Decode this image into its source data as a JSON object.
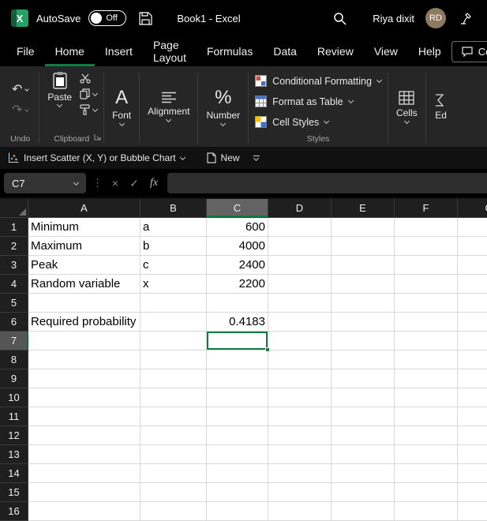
{
  "colors": {
    "accent_green": "#107C41",
    "logo_green": "#21A366",
    "logo_green_dark": "#185C37",
    "avatar_bg": "#8E7962",
    "icon_blue": "#5B9BD5"
  },
  "icons": {
    "undo": "↶",
    "redo": "↷",
    "vertical_dots": "⋮",
    "close": "×",
    "check": "✓",
    "logo_letter": "X"
  },
  "title_bar": {
    "autosave_label": "AutoSave",
    "autosave_state": "Off",
    "workbook_title": "Book1 -  Excel",
    "user_name": "Riya dixit",
    "user_initials": "RD"
  },
  "menu": {
    "items": [
      {
        "label": "File"
      },
      {
        "label": "Home",
        "active": true
      },
      {
        "label": "Insert"
      },
      {
        "label": "Page Layout"
      },
      {
        "label": "Formulas"
      },
      {
        "label": "Data"
      },
      {
        "label": "Review"
      },
      {
        "label": "View"
      },
      {
        "label": "Help"
      }
    ],
    "comments_label": "Com"
  },
  "ribbon": {
    "paste_label": "Paste",
    "font_button_label": "Font",
    "font_glyph": "A",
    "alignment_button_label": "Alignment",
    "number_button_label": "Number",
    "number_glyph": "%",
    "conditional_formatting_label": "Conditional Formatting",
    "format_as_table_label": "Format as Table",
    "cell_styles_label": "Cell Styles",
    "cells_button_label": "Cells",
    "editing_button_label": "Ed",
    "group_labels": {
      "undo": "Undo",
      "clipboard": "Clipboard",
      "styles": "Styles"
    }
  },
  "quick_toolbar": {
    "scatter_label": "Insert Scatter (X, Y) or Bubble Chart",
    "new_label": "New"
  },
  "formula_bar": {
    "name_box": "C7",
    "fx_label": "fx",
    "formula_value": ""
  },
  "sheet": {
    "columns": [
      "A",
      "B",
      "C",
      "D",
      "E",
      "F",
      "G"
    ],
    "selected_column": "C",
    "selected_row": 7,
    "selected_cell": "C7",
    "rows": [
      {
        "n": 1,
        "A": "Minimum",
        "B": "a",
        "C": "600"
      },
      {
        "n": 2,
        "A": "Maximum",
        "B": "b",
        "C": "4000"
      },
      {
        "n": 3,
        "A": "Peak",
        "B": "c",
        "C": "2400"
      },
      {
        "n": 4,
        "A": "Random variable",
        "B": "x",
        "C": "2200"
      },
      {
        "n": 5
      },
      {
        "n": 6,
        "A": "Required probability",
        "C": "0.4183"
      },
      {
        "n": 7
      },
      {
        "n": 8
      },
      {
        "n": 9
      },
      {
        "n": 10
      },
      {
        "n": 11
      },
      {
        "n": 12
      },
      {
        "n": 13
      },
      {
        "n": 14
      },
      {
        "n": 15
      },
      {
        "n": 16
      }
    ]
  }
}
